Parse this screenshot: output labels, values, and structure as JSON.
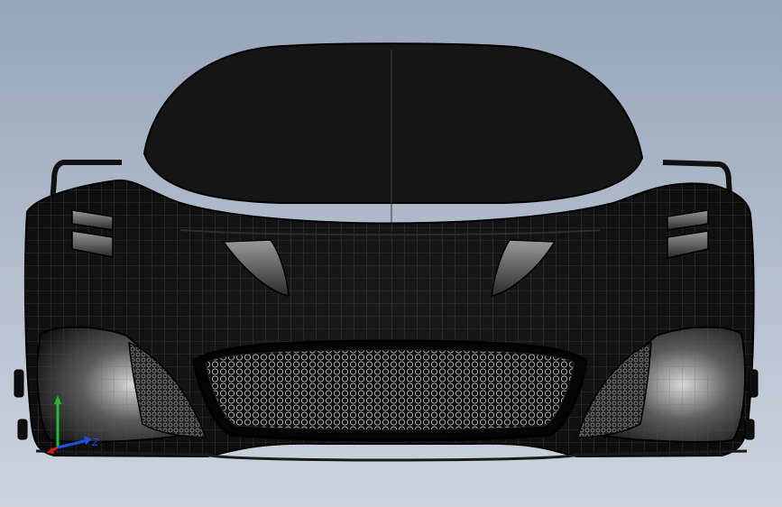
{
  "viewport": {
    "background_top": "#98a6ba",
    "background_bottom": "#cbd2dc",
    "model_name": "car-body-front-view"
  },
  "triad": {
    "x_axis": {
      "label": "",
      "color": "#d21c1c"
    },
    "y_axis": {
      "label": "",
      "color": "#1fbf2a"
    },
    "z_axis": {
      "label": "Z",
      "color": "#2050e8"
    }
  }
}
